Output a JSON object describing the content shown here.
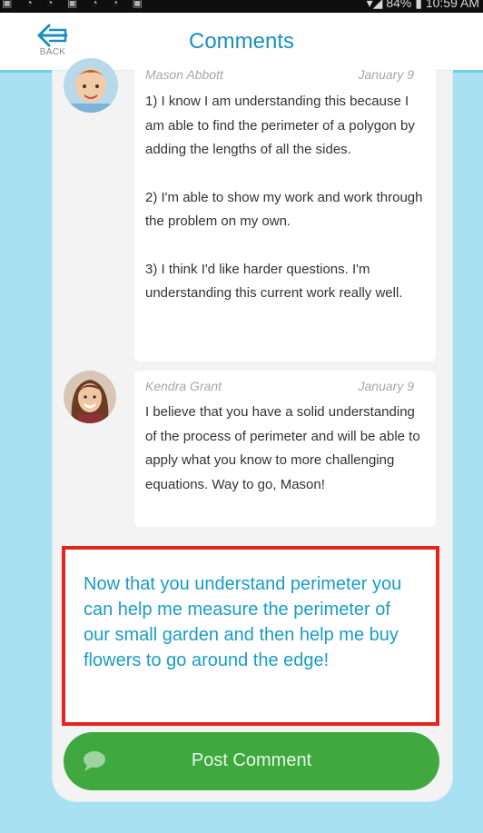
{
  "status_bar": {
    "right_text": "▾◢ 84% ▮ 10:59 AM"
  },
  "header": {
    "back_label": "BACK",
    "title": "Comments"
  },
  "comments": [
    {
      "author": "Mason Abbott",
      "date": "January 9",
      "paragraphs": [
        "1) I know I am understanding this because I am able to find the perimeter of a polygon by adding the lengths of all the sides.",
        "2) I'm able to show my work and work through the problem on my own.",
        "3) I think I'd like harder questions. I'm understanding this current work really well."
      ]
    },
    {
      "author": "Kendra Grant",
      "date": "January 9",
      "paragraphs": [
        "I believe that you have a solid understanding of the process of perimeter and will be able to apply what you know to more challenging equations. Way to go, Mason!"
      ]
    }
  ],
  "compose": {
    "value": "Now that you understand perimeter you can help me measure the perimeter of our small garden and then help me buy flowers to go around the edge!"
  },
  "post_button": {
    "label": "Post Comment"
  },
  "colors": {
    "accent": "#1a8fbf",
    "background": "#a9e1f3",
    "post_button": "#3fa93f",
    "highlight_border": "#e6241e"
  }
}
